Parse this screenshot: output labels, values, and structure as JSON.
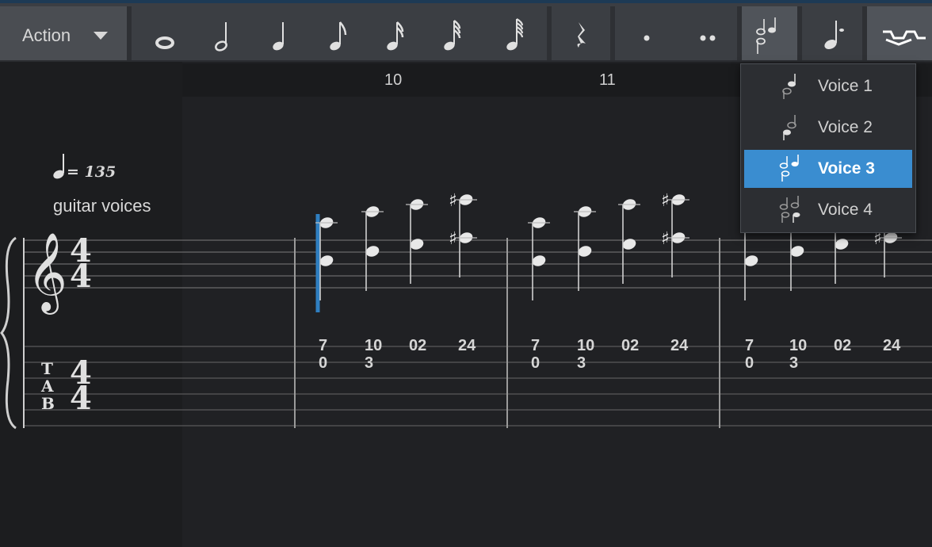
{
  "toolbar": {
    "action_label": "Action",
    "buttons": [
      {
        "name": "whole-note-icon"
      },
      {
        "name": "half-note-icon"
      },
      {
        "name": "quarter-note-icon"
      },
      {
        "name": "eighth-note-icon"
      },
      {
        "name": "sixteenth-note-icon"
      },
      {
        "name": "thirty-second-note-icon"
      },
      {
        "name": "sixty-fourth-note-icon"
      },
      {
        "name": "quarter-rest-icon"
      },
      {
        "name": "dot-icon"
      },
      {
        "name": "double-dot-icon"
      },
      {
        "name": "voice-select-icon"
      },
      {
        "name": "grace-note-icon"
      },
      {
        "name": "tuplet-icon"
      }
    ]
  },
  "ruler": {
    "bars": [
      "10",
      "11"
    ]
  },
  "track": {
    "tempo_value": "= 135",
    "name": "guitar voices"
  },
  "tab": {
    "frets": [
      [
        "7",
        "0"
      ],
      [
        "10",
        "3"
      ],
      [
        "02",
        ""
      ],
      [
        "24",
        ""
      ],
      [
        "7",
        "0"
      ],
      [
        "10",
        "3"
      ],
      [
        "02",
        ""
      ],
      [
        "24",
        ""
      ],
      [
        "7",
        "0"
      ],
      [
        "10",
        "3"
      ],
      [
        "02",
        ""
      ],
      [
        "24",
        ""
      ]
    ]
  },
  "voice_menu": {
    "items": [
      "Voice 1",
      "Voice 2",
      "Voice 3",
      "Voice 4"
    ],
    "selected": "Voice 3",
    "highlight_color": "#3a8dd0"
  }
}
